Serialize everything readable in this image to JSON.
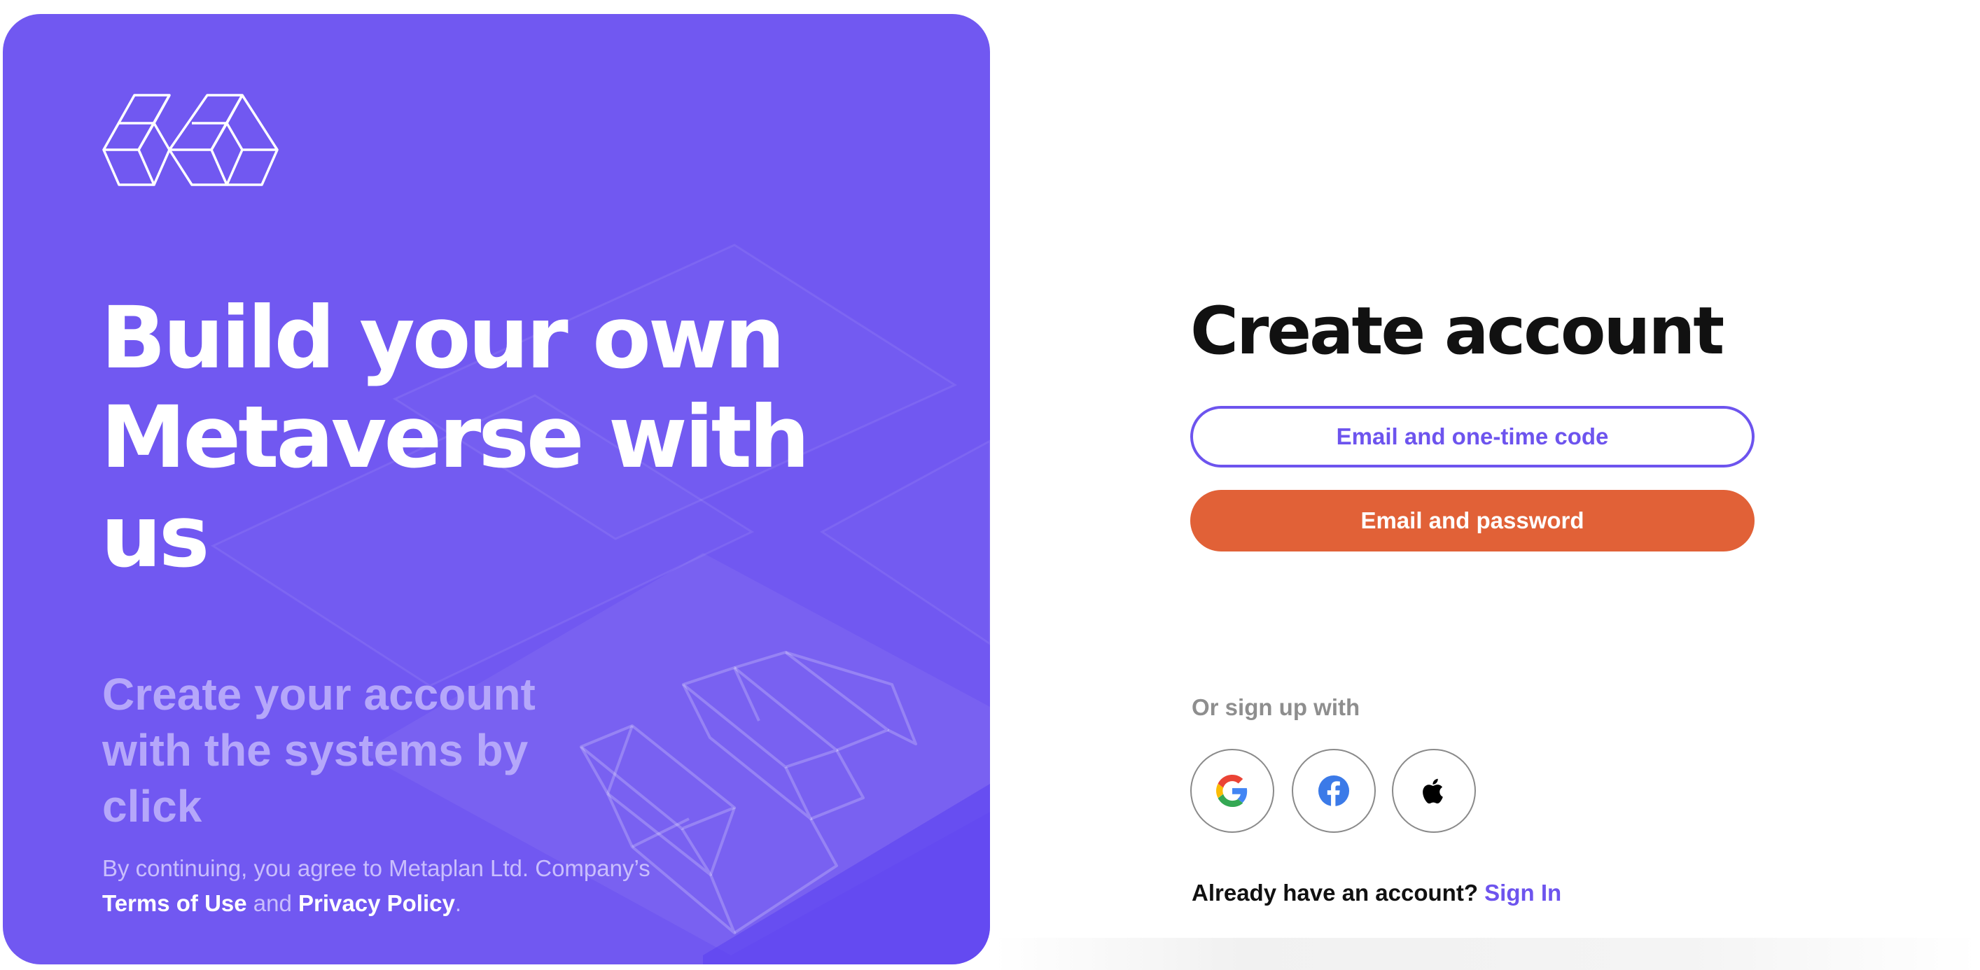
{
  "hero": {
    "logo": "metaplan-cubes-logo",
    "title": "Build your own Metaverse with us",
    "subtitle": "Create your account with the systems by click",
    "legal": {
      "prefix": "By continuing, you agree to Metaplan Ltd. Company’s ",
      "terms": "Terms of Use",
      "and": " and ",
      "privacy": "Privacy Policy",
      "suffix": "."
    },
    "background_color": "#7158f1"
  },
  "form": {
    "title": "Create account",
    "otp_button": "Email and one-time code",
    "password_button": "Email and password",
    "or_text": "Or sign up with",
    "social": [
      {
        "name": "google",
        "icon": "google-icon"
      },
      {
        "name": "facebook",
        "icon": "facebook-icon"
      },
      {
        "name": "apple",
        "icon": "apple-icon"
      }
    ],
    "already_text": "Already have an account?",
    "signin_link": "Sign In"
  },
  "colors": {
    "accent_purple": "#6d54ee",
    "primary_orange": "#e16137",
    "muted_gray": "#8e8e8e"
  }
}
